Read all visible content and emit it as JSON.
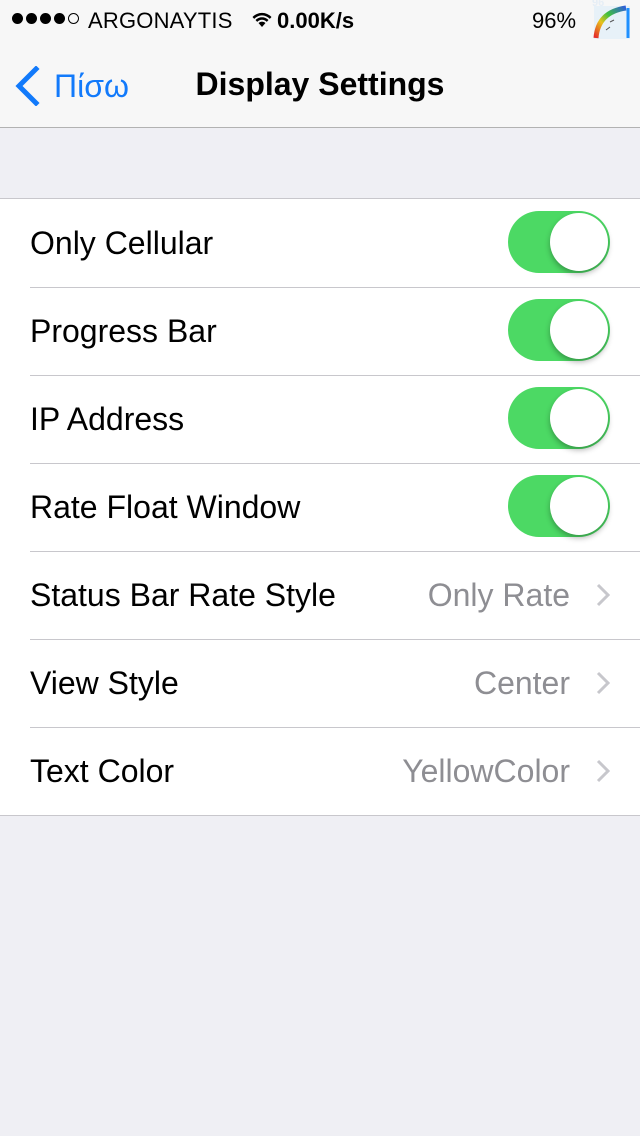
{
  "status_bar": {
    "signal_bars_filled": 4,
    "signal_bars_total": 5,
    "carrier": "ARGONAYTIS",
    "network_rate": "0.00K/s",
    "battery": "96%",
    "gauge_value": "96",
    "icons": [
      "signal-dots-icon",
      "wifi-icon",
      "battery-gauge-icon"
    ]
  },
  "nav": {
    "back_label": "Πίσω",
    "title": "Display Settings",
    "accent_color": "#127afb"
  },
  "settings": {
    "toggles": [
      {
        "label": "Only Cellular",
        "on": true
      },
      {
        "label": "Progress Bar",
        "on": true
      },
      {
        "label": "IP Address",
        "on": true
      },
      {
        "label": "Rate Float Window",
        "on": true
      }
    ],
    "options": [
      {
        "label": "Status Bar Rate Style",
        "value": "Only Rate"
      },
      {
        "label": "View Style",
        "value": "Center"
      },
      {
        "label": "Text Color",
        "value": "YellowColor"
      }
    ],
    "switch_on_color": "#4cd964"
  }
}
